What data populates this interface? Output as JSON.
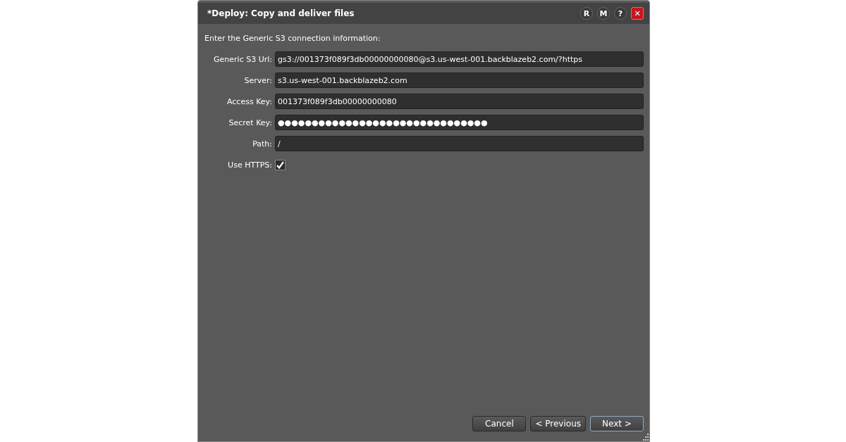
{
  "window": {
    "title": "*Deploy: Copy and deliver files",
    "title_buttons": [
      {
        "label": "R",
        "kind": "round"
      },
      {
        "label": "M",
        "kind": "round"
      },
      {
        "label": "?",
        "kind": "round"
      },
      {
        "label": "✕",
        "kind": "close"
      }
    ]
  },
  "instruction": "Enter the Generic S3 connection information:",
  "fields": [
    {
      "label": "Generic S3 Url:",
      "value": "gs3://001373f089f3db00000000080@s3.us-west-001.backblazeb2.com/?https"
    },
    {
      "label": "Server:",
      "value": "s3.us-west-001.backblazeb2.com"
    },
    {
      "label": "Access Key:",
      "value": "001373f089f3db00000000080"
    },
    {
      "label": "Secret Key:",
      "value": "●●●●●●●●●●●●●●●●●●●●●●●●●●●●●●●"
    },
    {
      "label": "Path:",
      "value": "/"
    }
  ],
  "use_https": {
    "label": "Use HTTPS:",
    "checked": true
  },
  "buttons": [
    {
      "label": "Cancel",
      "default": false
    },
    {
      "label": "< Previous",
      "default": false
    },
    {
      "label": "Next >",
      "default": true
    }
  ]
}
